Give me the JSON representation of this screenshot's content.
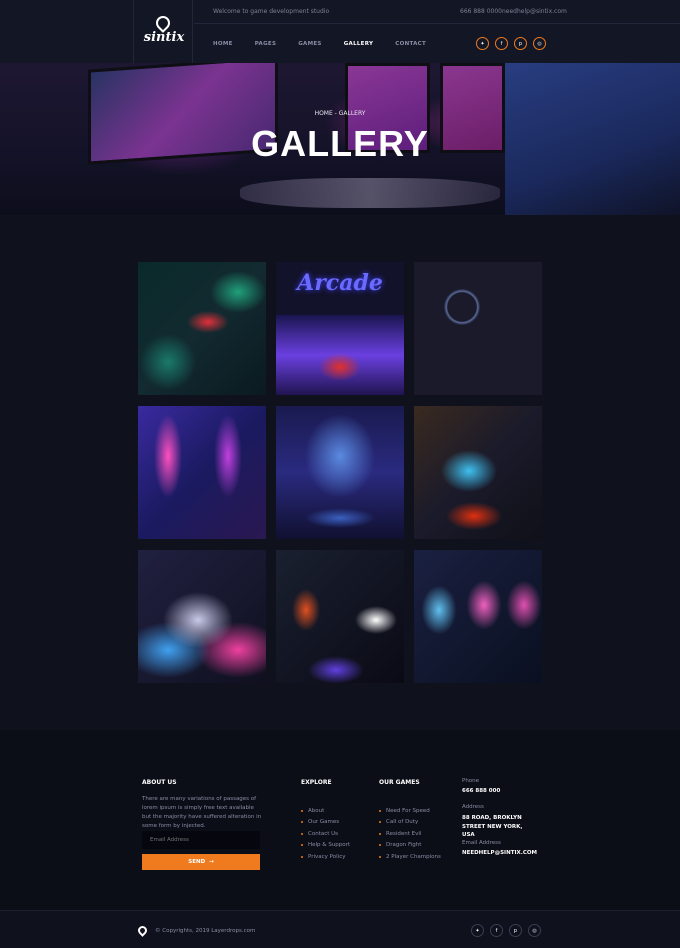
{
  "brand": {
    "name": "sintix"
  },
  "topbar": {
    "welcome": "Welcome to game development studio",
    "phone": "666 888 0000",
    "email": "needhelp@sintix.com"
  },
  "nav": {
    "items": [
      "HOME",
      "PAGES",
      "GAMES",
      "GALLERY",
      "CONTACT"
    ],
    "active": "GALLERY"
  },
  "social": [
    "twitter-icon",
    "facebook-icon",
    "pinterest-icon",
    "instagram-icon"
  ],
  "hero": {
    "breadcrumb": "HOME - GALLERY",
    "title": "GALLERY"
  },
  "gallery": {
    "items": [
      {
        "alt": "neon pinball machine"
      },
      {
        "alt": "arcade neon sign"
      },
      {
        "alt": "gaming pc interior"
      },
      {
        "alt": "neon arcade cabinets"
      },
      {
        "alt": "fantasy cave game scene"
      },
      {
        "alt": "gamer at desktop"
      },
      {
        "alt": "retro computers"
      },
      {
        "alt": "arcade player"
      },
      {
        "alt": "gaming monitors"
      }
    ]
  },
  "footer": {
    "about": {
      "heading": "ABOUT US",
      "text": "There are many variations of passages of lorem ipsum is simply free text available but the majority have suffered alteration in some form by injected.",
      "email_placeholder": "Email Address",
      "send_label": "SEND"
    },
    "explore": {
      "heading": "EXPLORE",
      "items": [
        "About",
        "Our Games",
        "Contact Us",
        "Help & Support",
        "Privacy Policy"
      ]
    },
    "our_games": {
      "heading": "OUR GAMES",
      "items": [
        "Need For Speed",
        "Call of Duty",
        "Resident Evil",
        "Dragon Fight",
        "2 Player Champions"
      ]
    },
    "contact": {
      "phone_label": "Phone",
      "phone": "666 888 000",
      "address_label": "Address",
      "address": "88 ROAD, BROKLYN STREET NEW YORK, USA",
      "email_label": "Email Address",
      "email": "NEEDHELP@SINTIX.COM"
    },
    "copyright": "© Copyrights, 2019 Layerdrops.com"
  },
  "colors": {
    "accent": "#f07b1f",
    "bg": "#0f111d",
    "header": "#131624"
  }
}
